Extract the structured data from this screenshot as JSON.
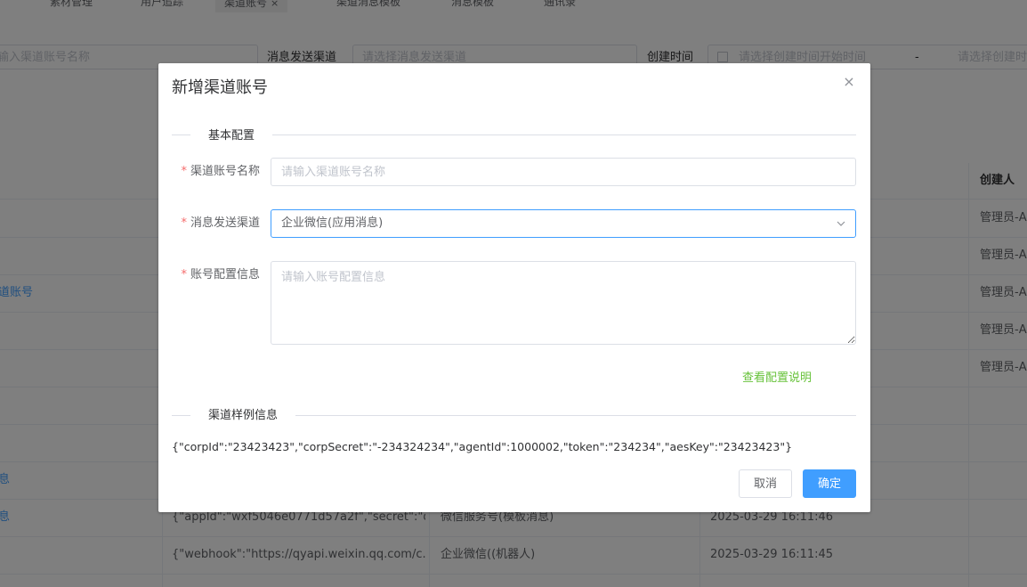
{
  "tabs": [
    {
      "label": "素材管理"
    },
    {
      "label": "用户追踪"
    },
    {
      "label": "渠道账号",
      "close": "×"
    },
    {
      "label": "渠道消息模板"
    },
    {
      "label": "消息模板"
    },
    {
      "label": "通讯录"
    }
  ],
  "filters": {
    "account_name_placeholder": "输入渠道账号名称",
    "channel_label": "消息发送渠道",
    "channel_placeholder": "请选择消息发送渠道",
    "created_label": "创建时间",
    "created_start_placeholder": "请选择创建时间开始时间",
    "range_sep": "-",
    "created_end_placeholder": "请选择创建时间结束时间"
  },
  "table": {
    "creator_header": "创建人",
    "rows": [
      {
        "name": "",
        "config": "",
        "channel": "",
        "time": "",
        "creator": "管理员-A"
      },
      {
        "name": "",
        "config": "",
        "channel": "",
        "time": "",
        "creator": "管理员-A"
      },
      {
        "name": "道账号",
        "config": "",
        "channel": "",
        "time": "",
        "creator": "管理员-A"
      },
      {
        "name": "",
        "config": "",
        "channel": "",
        "time": "",
        "creator": "管理员-A"
      },
      {
        "name": "",
        "config": "",
        "channel": "",
        "time": "",
        "creator": "管理员-A"
      },
      {
        "name": "",
        "config": "",
        "channel": "",
        "time": "",
        "creator": ""
      },
      {
        "name": "",
        "config": "",
        "channel": "",
        "time": "",
        "creator": ""
      },
      {
        "name": "息",
        "config": "",
        "channel": "",
        "time": "",
        "creator": ""
      },
      {
        "name": "息",
        "config": "{\"appId\":\"wxf5046e0771d57a2f\",\"secret\":\"d...",
        "channel": "微信服务号(模板消息)",
        "time": "2025-03-29 16:11:46",
        "creator": ""
      },
      {
        "name": "",
        "config": "{\"webhook\":\"https://qyapi.weixin.qq.com/c...",
        "channel": "企业微信((机器人)",
        "time": "2025-03-29 16:11:45",
        "creator": ""
      }
    ]
  },
  "dialog": {
    "title": "新增渠道账号",
    "close_icon": "×",
    "section_basic": "基本配置",
    "required_mark": "*",
    "name_label": "渠道账号名称",
    "name_placeholder": "请输入渠道账号名称",
    "channel_label": "消息发送渠道",
    "channel_value": "企业微信(应用消息)",
    "config_label": "账号配置信息",
    "config_placeholder": "请输入账号配置信息",
    "config_help_link": "查看配置说明",
    "section_sample": "渠道样例信息",
    "sample_text": "{\"corpId\":\"23423423\",\"corpSecret\":\"-234324234\",\"agentId\":1000002,\"token\":\"234234\",\"aesKey\":\"23423423\"}",
    "cancel_label": "取消",
    "ok_label": "确定"
  },
  "colors": {
    "primary": "#409eff",
    "success": "#67c23a",
    "danger": "#f56c6c"
  }
}
